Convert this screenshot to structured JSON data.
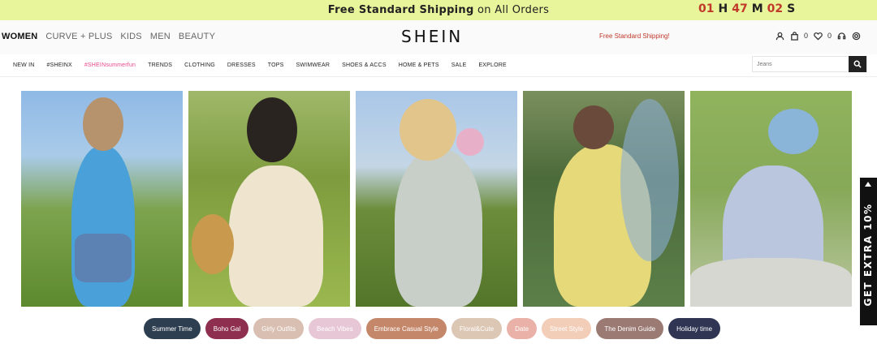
{
  "promo": {
    "shipping_bold": "Free Standard Shipping",
    "shipping_rest": "on All Orders",
    "countdown": {
      "hours": "01",
      "h": "H",
      "minutes": "47",
      "m": "M",
      "seconds": "02",
      "s": "S"
    }
  },
  "header": {
    "categories": [
      "WOMEN",
      "CURVE + PLUS",
      "KIDS",
      "MEN",
      "BEAUTY"
    ],
    "logo": "SHEIN",
    "free_shipping": "Free Standard Shipping!",
    "bag_count": "0",
    "wishlist_count": "0"
  },
  "nav": {
    "items": [
      "NEW IN",
      "#SHEINX",
      "#SHEINsummerfun",
      "TRENDS",
      "CLOTHING",
      "DRESSES",
      "TOPS",
      "SWIMWEAR",
      "SHOES & ACCS",
      "HOME & PETS",
      "SALE",
      "EXPLORE"
    ],
    "search_placeholder": "Jeans"
  },
  "side_tab": {
    "label": "GET EXTRA 10%"
  },
  "chips": [
    {
      "label": "Summer Time",
      "color": "#2d3e50"
    },
    {
      "label": "Boho Gal",
      "color": "#8e2f4f"
    },
    {
      "label": "Girly Outfits",
      "color": "#d8bfb1"
    },
    {
      "label": "Beach Vibes",
      "color": "#e7c7d5"
    },
    {
      "label": "Embrace Casual Style",
      "color": "#c5876a"
    },
    {
      "label": "Floral&Cute",
      "color": "#dcc6b4"
    },
    {
      "label": "Date",
      "color": "#e9b1a8"
    },
    {
      "label": "Street Style",
      "color": "#f2cdb7"
    },
    {
      "label": "The Denim Guide",
      "color": "#9b7a74"
    },
    {
      "label": "Holiday time",
      "color": "#2f3552"
    }
  ]
}
